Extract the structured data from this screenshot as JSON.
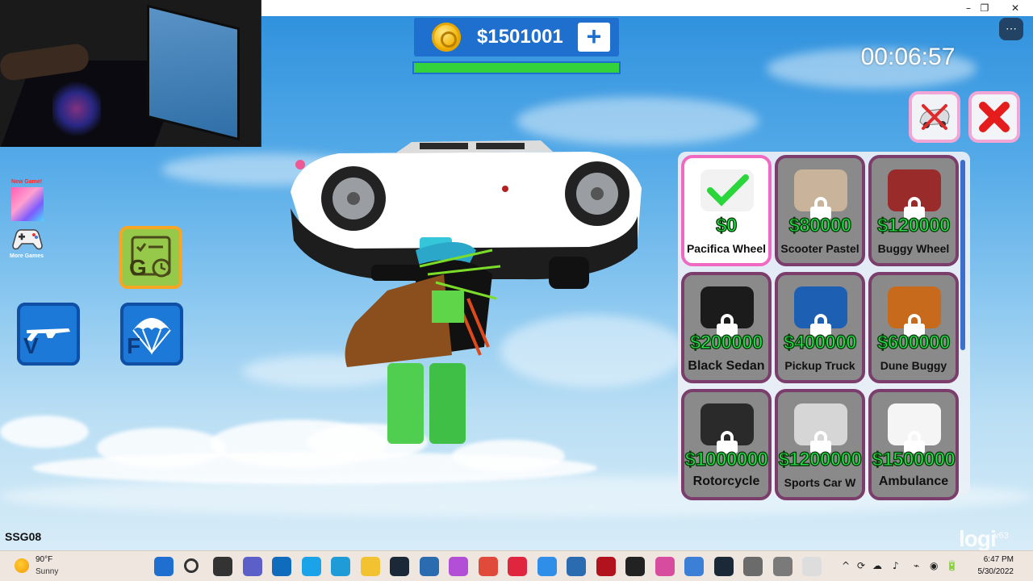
{
  "window": {
    "minimize": "–",
    "maximize": "❐",
    "close": "✕"
  },
  "hud": {
    "money": "$1501001",
    "add_money": "+",
    "progress_fraction": 1.0,
    "timer": "00:06:57",
    "new_game_label": "New Game!",
    "more_games_label": "More Games",
    "gamepass_key": "G",
    "weapon_key": "V",
    "parachute_key": "F",
    "server_name": "SSG08",
    "watermark": "logi",
    "version": "v63"
  },
  "shop": {
    "items": [
      {
        "price": "$0",
        "name": "Pacifica Wheel",
        "owned": true,
        "thumb_color": "#f2f2f2"
      },
      {
        "price": "$80000",
        "name": "Scooter Pastel",
        "owned": false,
        "thumb_color": "#c9b39a"
      },
      {
        "price": "$120000",
        "name": "Buggy Wheel",
        "owned": false,
        "thumb_color": "#9a2b2b"
      },
      {
        "price": "$200000",
        "name": "Black Sedan",
        "owned": false,
        "thumb_color": "#1b1b1b"
      },
      {
        "price": "$400000",
        "name": "Pickup Truck",
        "owned": false,
        "thumb_color": "#1d5fb3"
      },
      {
        "price": "$600000",
        "name": "Dune Buggy",
        "owned": false,
        "thumb_color": "#c86a1c"
      },
      {
        "price": "$1000000",
        "name": "Rotorcycle",
        "owned": false,
        "thumb_color": "#2a2a2a"
      },
      {
        "price": "$1200000",
        "name": "Sports Car W",
        "owned": false,
        "thumb_color": "#d6d6d6"
      },
      {
        "price": "$1500000",
        "name": "Ambulance",
        "owned": false,
        "thumb_color": "#f5f5f5"
      }
    ]
  },
  "taskbar": {
    "weather_temp": "90°F",
    "weather_desc": "Sunny",
    "time": "6:47 PM",
    "date": "5/30/2022",
    "apps": [
      {
        "name": "start",
        "color": "#1f6fd1"
      },
      {
        "name": "search",
        "color": "#333333"
      },
      {
        "name": "task-view",
        "color": "#333333"
      },
      {
        "name": "teams",
        "color": "#5b5fc7"
      },
      {
        "name": "outlook",
        "color": "#0f6cbd"
      },
      {
        "name": "skype",
        "color": "#1aa3e8"
      },
      {
        "name": "edge",
        "color": "#1f9bd8"
      },
      {
        "name": "file-explorer",
        "color": "#f2c230"
      },
      {
        "name": "steam",
        "color": "#1b2838"
      },
      {
        "name": "store",
        "color": "#2b6cb0"
      },
      {
        "name": "app-purple",
        "color": "#b24fd6"
      },
      {
        "name": "chrome",
        "color": "#e04a3a"
      },
      {
        "name": "health",
        "color": "#e0263f"
      },
      {
        "name": "dropbox",
        "color": "#2f8fe8"
      },
      {
        "name": "mail",
        "color": "#2b6cb0"
      },
      {
        "name": "app-red",
        "color": "#b1121c"
      },
      {
        "name": "roblox-studio",
        "color": "#222222"
      },
      {
        "name": "app-pink",
        "color": "#d84ca0"
      },
      {
        "name": "notepad",
        "color": "#3c7fd6"
      },
      {
        "name": "steam-2",
        "color": "#1b2838"
      },
      {
        "name": "clock-app",
        "color": "#6b6b6b"
      },
      {
        "name": "mouse-app",
        "color": "#7a7a7a"
      },
      {
        "name": "roblox",
        "color": "#dddddd"
      }
    ],
    "tray": [
      "^",
      "⟳",
      "☁",
      "♪",
      "⌁",
      "◉",
      "🔋"
    ]
  }
}
